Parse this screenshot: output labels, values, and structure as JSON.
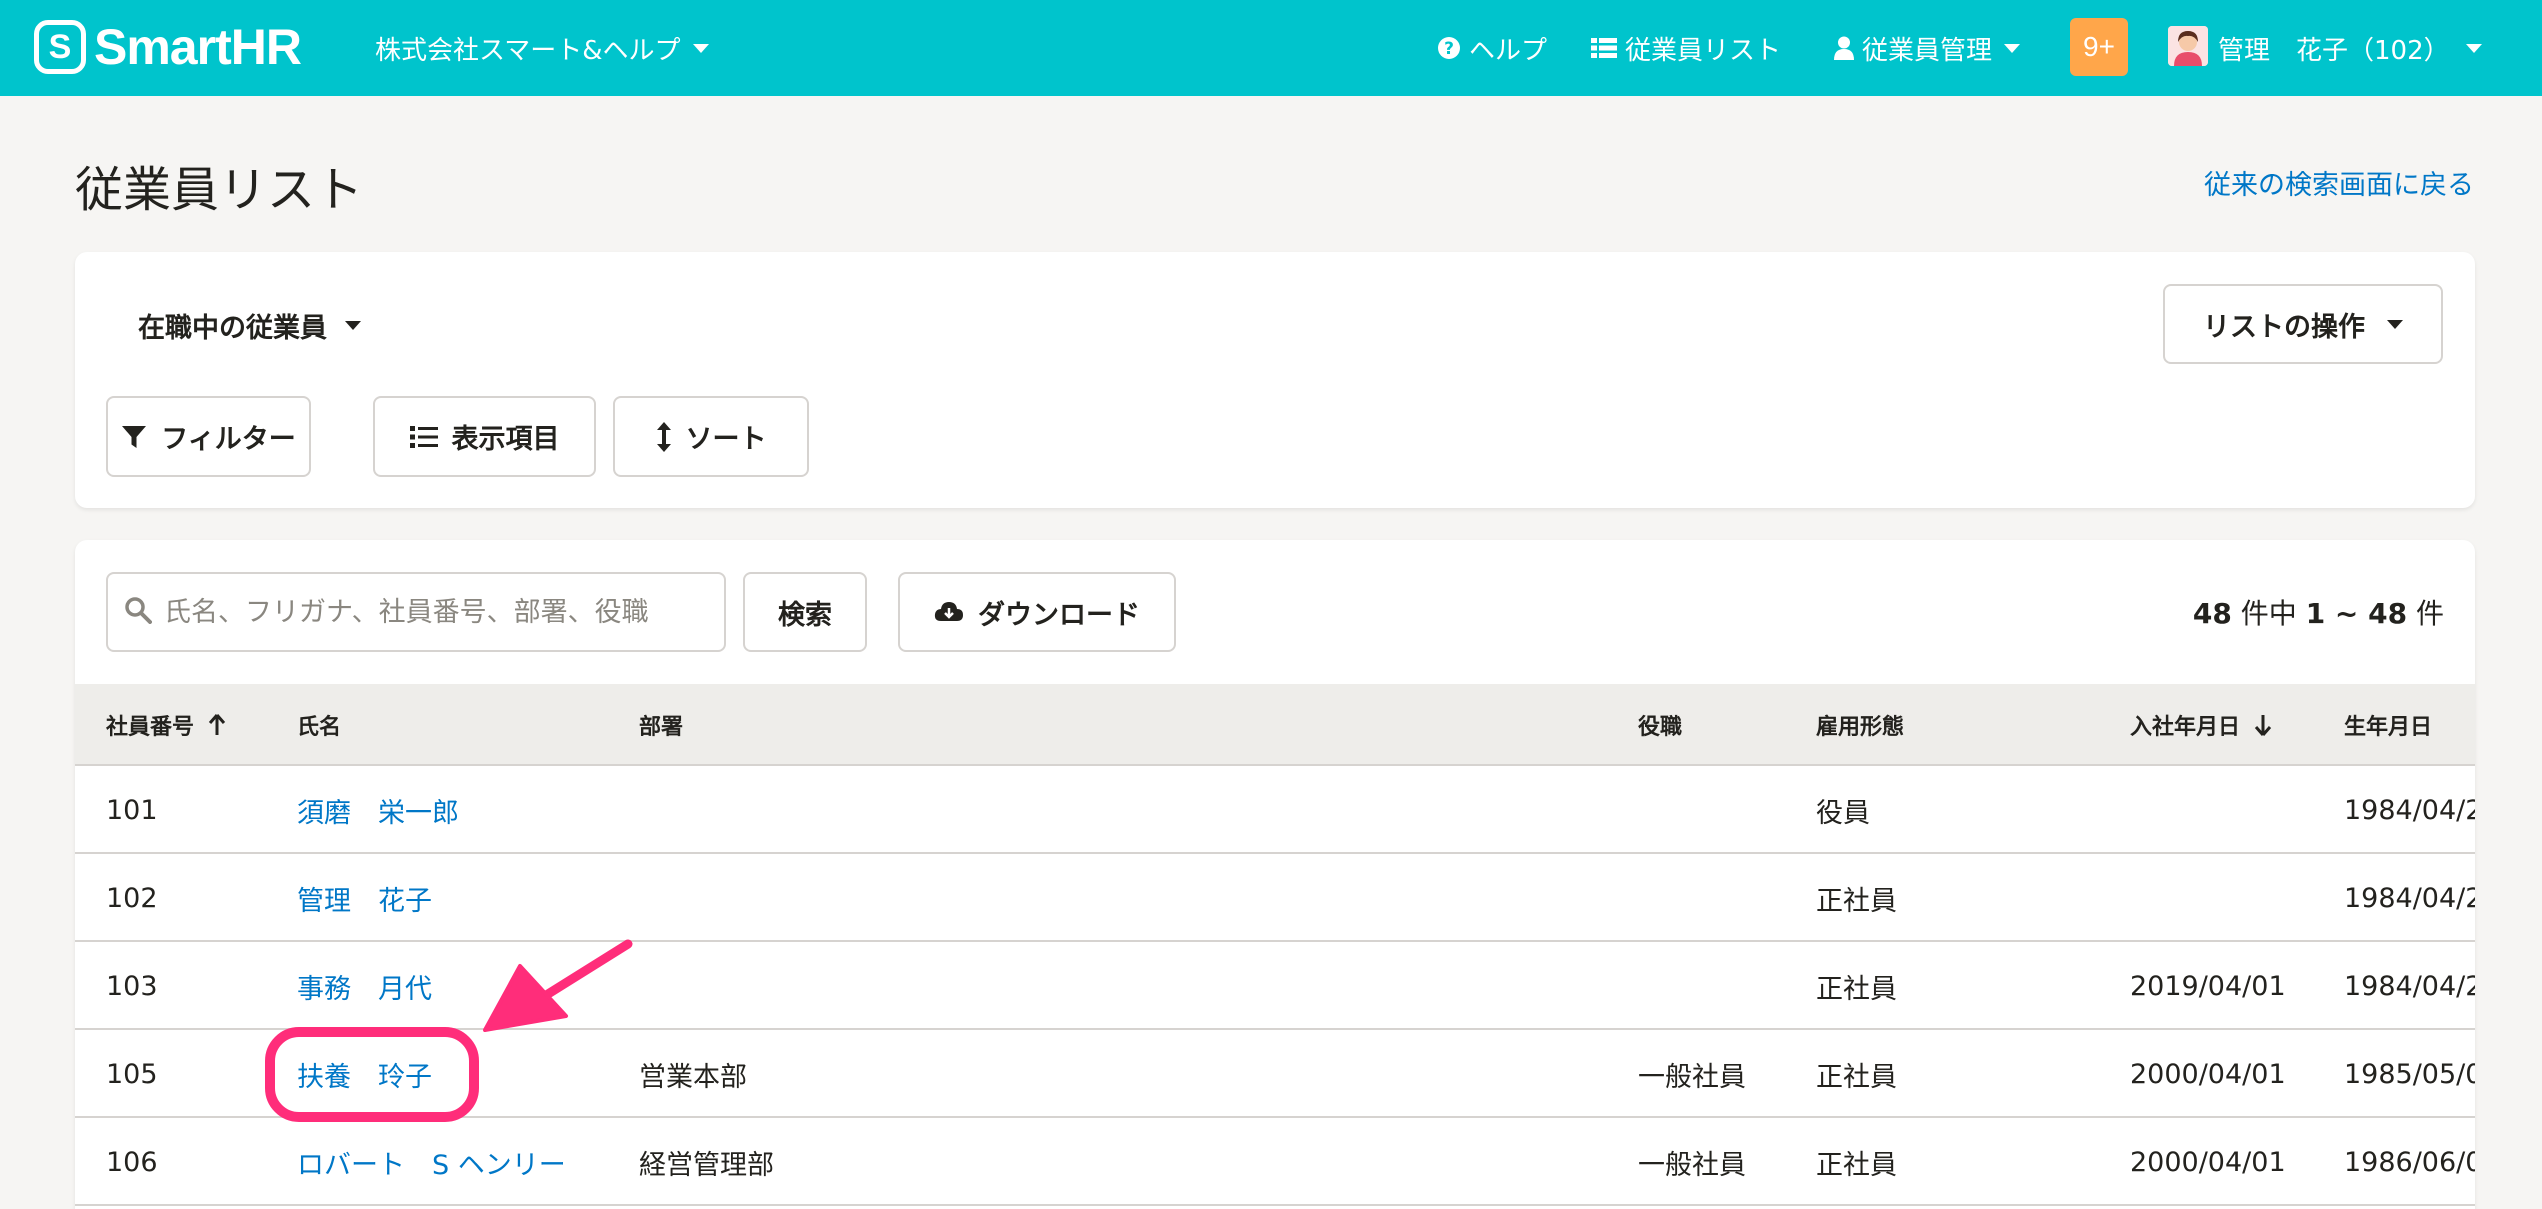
{
  "header": {
    "logo_mark": "S",
    "logo_text": "SmartHR",
    "company": "株式会社スマート&ヘルプ",
    "help": "ヘルプ",
    "employee_list": "従業員リスト",
    "employee_mgmt": "従業員管理",
    "notifications": "9+",
    "user": "管理　花子（102）"
  },
  "page": {
    "title": "従業員リスト",
    "back_link": "従来の検索画面に戻る"
  },
  "controls": {
    "scope": "在職中の従業員",
    "list_ops": "リストの操作",
    "filter": "フィルター",
    "columns": "表示項目",
    "sort": "ソート",
    "search_placeholder": "氏名、フリガナ、社員番号、部署、役職",
    "search_button": "検索",
    "download": "ダウンロード",
    "count_total": "48",
    "count_mid": " 件中 ",
    "count_range": "1 ~ 48",
    "count_suffix": " 件"
  },
  "table": {
    "headers": {
      "emp_no": "社員番号",
      "name": "氏名",
      "department": "部署",
      "position": "役職",
      "employment_type": "雇用形態",
      "hire_date": "入社年月日",
      "birth_date": "生年月日"
    },
    "rows": [
      {
        "emp_no": "101",
        "name": "須磨　栄一郎",
        "department": "",
        "position": "",
        "employment_type": "役員",
        "hire_date": "",
        "birth_date": "1984/04/2"
      },
      {
        "emp_no": "102",
        "name": "管理　花子",
        "department": "",
        "position": "",
        "employment_type": "正社員",
        "hire_date": "",
        "birth_date": "1984/04/2"
      },
      {
        "emp_no": "103",
        "name": "事務　月代",
        "department": "",
        "position": "",
        "employment_type": "正社員",
        "hire_date": "2019/04/01",
        "birth_date": "1984/04/2"
      },
      {
        "emp_no": "105",
        "name": "扶養　玲子",
        "department": "営業本部",
        "position": "一般社員",
        "employment_type": "正社員",
        "hire_date": "2000/04/01",
        "birth_date": "1985/05/0"
      },
      {
        "emp_no": "106",
        "name": "ロバート　S ヘンリー",
        "department": "経営管理部",
        "position": "一般社員",
        "employment_type": "正社員",
        "hire_date": "2000/04/01",
        "birth_date": "1986/06/0"
      }
    ]
  },
  "colors": {
    "header_bg": "#00c4cc",
    "link": "#0077c7",
    "badge": "#ffa64a",
    "annotation": "#ff2d7a"
  }
}
